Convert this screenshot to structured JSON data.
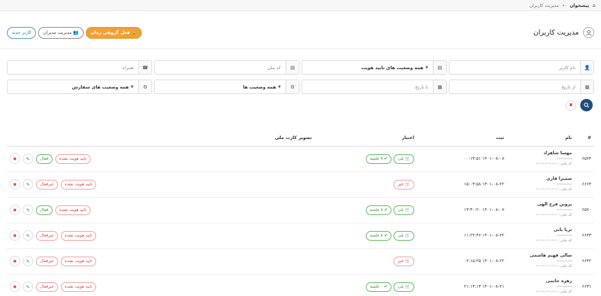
{
  "breadcrumb": {
    "home": "پیشخوان",
    "separator": "←",
    "current": "مدیریت کاربران"
  },
  "header": {
    "title": "مدیریت کاربران",
    "buttons": {
      "group_time": "فعل گروهی زمان",
      "admins": "مدیریت مدیران",
      "new_user": "کاربر جدید"
    }
  },
  "filters": {
    "username_placeholder": "نام کاربر",
    "verify_status": "همه وضعیت های تایید هویت",
    "national_code_placeholder": "کد ملی",
    "mobile_placeholder": "همراه",
    "from_date_placeholder": "از تاریخ",
    "to_date_placeholder": "تا تاریخ",
    "all_status": "همه وضعیت ها",
    "order_status": "همه وضعیت های سفارش"
  },
  "table": {
    "headers": {
      "num": "#",
      "name": "نام",
      "sabt": "ثبت",
      "etebar": "اعتبار",
      "national_card": "تصویر کارت ملی"
    },
    "yes_label": "بلی",
    "no_label": "خیر",
    "rows": [
      {
        "id": "۶۵۷۴",
        "name": "مهسا شاهزاد",
        "mobile": "••••••••••",
        "code_label": "کد ملی:",
        "code": "••••••••••",
        "date": "۱۴۰۱-۰۸-۰۸ ۰۰:۱۳:۵۱",
        "session": "۹ جلسه",
        "verify": "تایید هویت نشده",
        "active": "فعال"
      },
      {
        "id": "۶۶۶۴",
        "name": "سمیرا قاری",
        "mobile": "••••••••••",
        "code_label": "کد ملی:",
        "code": "••••••••••",
        "date": "۱۴۰۱-۰۸-۲۲ ۱۵:۰۳:۵۸",
        "session": "",
        "verify": "تایید هویت نشده",
        "active": "غیرفعال"
      },
      {
        "id": "۶۵۷۰",
        "name": "پروین فرخ الهی",
        "mobile": "••••••••••",
        "code_label": "کد ملی:",
        "code": "••••••••••",
        "date": "۱۴۰۱-۰۸-۰۷ ۱۳:۳۰:۲۰",
        "session": "۷ جلسه",
        "verify": "تایید هویت نشده",
        "active": "فعال"
      },
      {
        "id": "۶۶۴۳",
        "name": "ثریا بابی",
        "mobile": "••••••••••",
        "code_label": "کد ملی:",
        "code": "••••••••••",
        "date": "۱۴۰۱-۰۸-۲۲ ۱۱:۲۲:۴۶",
        "session": "۸ جلسه",
        "verify": "تایید هویت نشده",
        "active": "غیرفعال"
      },
      {
        "id": "۶۶۴۲",
        "name": "سالی قهیم هاشمی",
        "mobile": "••••••••••",
        "code_label": "کد ملی:",
        "code": "••••••••••",
        "date": "۱۴۰۱-۰۸-۲۲ ۰۲:۱۵:۲۵",
        "session": "",
        "verify": "تایید هویت نشده",
        "active": "غیرفعال"
      },
      {
        "id": "۶۶۳۱",
        "name": "زهره حاتمی",
        "mobile": "••••••••••",
        "code_label": "کد ملی:",
        "code": "••••••••••",
        "date": "۱۴۰۱-۰۸-۲۱ ۲۱:۱۳:۱۳",
        "session": "۰ جلسه",
        "verify": "تایید هویت نشده",
        "active": "غیرفعال"
      }
    ]
  }
}
